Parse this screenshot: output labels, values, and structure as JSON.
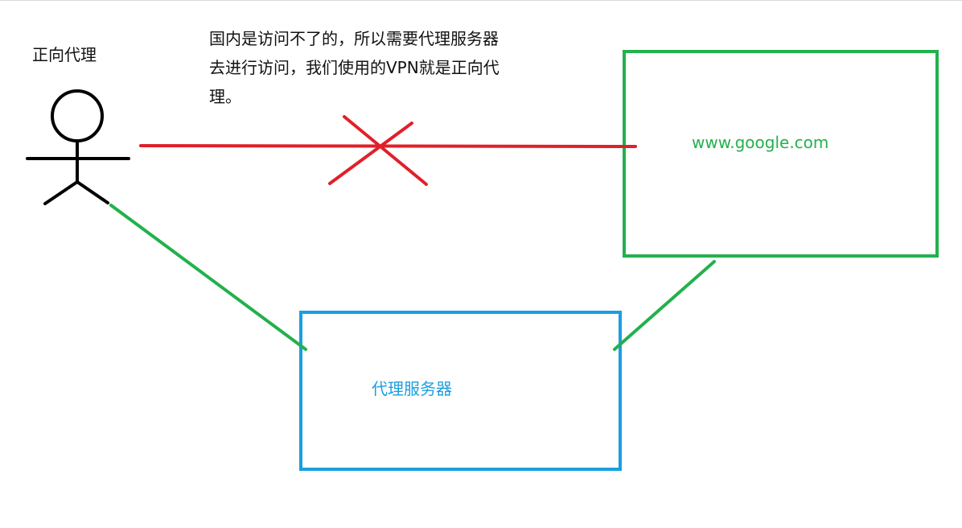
{
  "diagram": {
    "title": "正向代理",
    "note_lines": [
      "国内是访问不了的，所以需要代理服务器",
      "去进行访问，我们使用的VPN就是正向代",
      "理。"
    ],
    "nodes": {
      "user": {
        "icon": "stick-figure-icon"
      },
      "google": {
        "label": "www.google.com",
        "color": "#22b14c"
      },
      "proxy": {
        "label": "代理服务器",
        "color": "#1a9fe0"
      }
    },
    "edges": {
      "blocked": {
        "color": "#e0202a",
        "status": "blocked"
      },
      "allowed": {
        "color": "#22b14c"
      }
    },
    "colors": {
      "text": "#111111",
      "google_box": "#22b14c",
      "proxy_box": "#1a9fe0",
      "blocked_line": "#e0202a",
      "allowed_line": "#22b14c",
      "figure": "#000000"
    }
  }
}
